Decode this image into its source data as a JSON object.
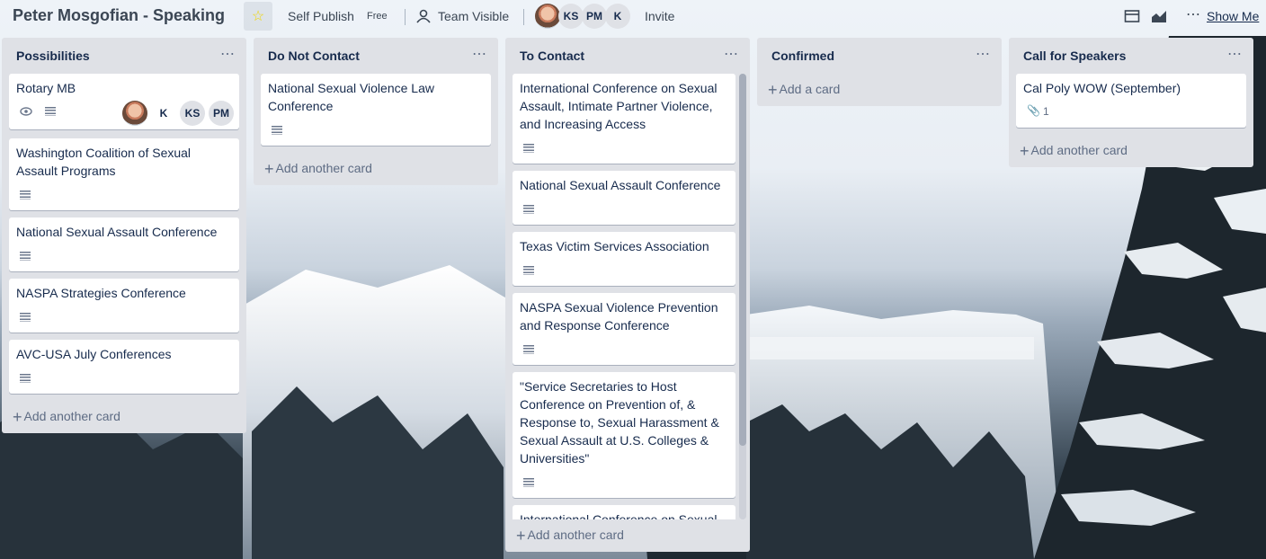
{
  "board": {
    "title": "Peter Mosgofian - Speaking",
    "workspace": "Self Publish",
    "plan": "Free",
    "visibility": "Team Visible",
    "invite_label": "Invite",
    "members": [
      "KS",
      "PM",
      "K"
    ],
    "show_menu_label": "Show Me"
  },
  "lists": [
    {
      "name": "Possibilities",
      "cards": [
        {
          "title": "Rotary MB",
          "members": [
            "K",
            "KS",
            "PM"
          ]
        },
        {
          "title": "Washington Coalition of Sexual Assault Programs"
        },
        {
          "title": "National Sexual Assault Conference"
        },
        {
          "title": "NASPA Strategies Conference"
        },
        {
          "title": "AVC-USA July Conferences"
        }
      ],
      "add_label": "Add another card"
    },
    {
      "name": "Do Not Contact",
      "cards": [
        {
          "title": "National Sexual Violence Law Conference"
        }
      ],
      "add_label": "Add another card"
    },
    {
      "name": "To Contact",
      "cards": [
        {
          "title": "International Conference on Sexual Assault, Intimate Partner Violence, and Increasing Access"
        },
        {
          "title": "National Sexual Assault Conference"
        },
        {
          "title": "Texas Victim Services Association"
        },
        {
          "title": "NASPA Sexual Violence Prevention and Response Conference"
        },
        {
          "title": "\"Service Secretaries to Host Conference on Prevention of, & Response to, Sexual Harassment & Sexual Assault at U.S. Colleges & Universities\""
        },
        {
          "title": "International Conference on Sexual"
        }
      ],
      "add_label": "Add another card"
    },
    {
      "name": "Confirmed",
      "cards": [],
      "add_label": "Add a card"
    },
    {
      "name": "Call for Speakers",
      "cards": [
        {
          "title": "Cal Poly WOW (September)",
          "attachments": "1"
        }
      ],
      "add_label": "Add another card"
    }
  ],
  "icons": {
    "star": "star-icon",
    "team": "team-icon",
    "description": "description-icon",
    "watch": "eye-icon",
    "attachment": "paperclip-icon",
    "list_menu": "ellipsis-icon"
  },
  "colors": {
    "list_bg": "#dfe1e6",
    "card_bg": "#ffffff",
    "star": "#f2d600",
    "text": "#172b4d"
  }
}
